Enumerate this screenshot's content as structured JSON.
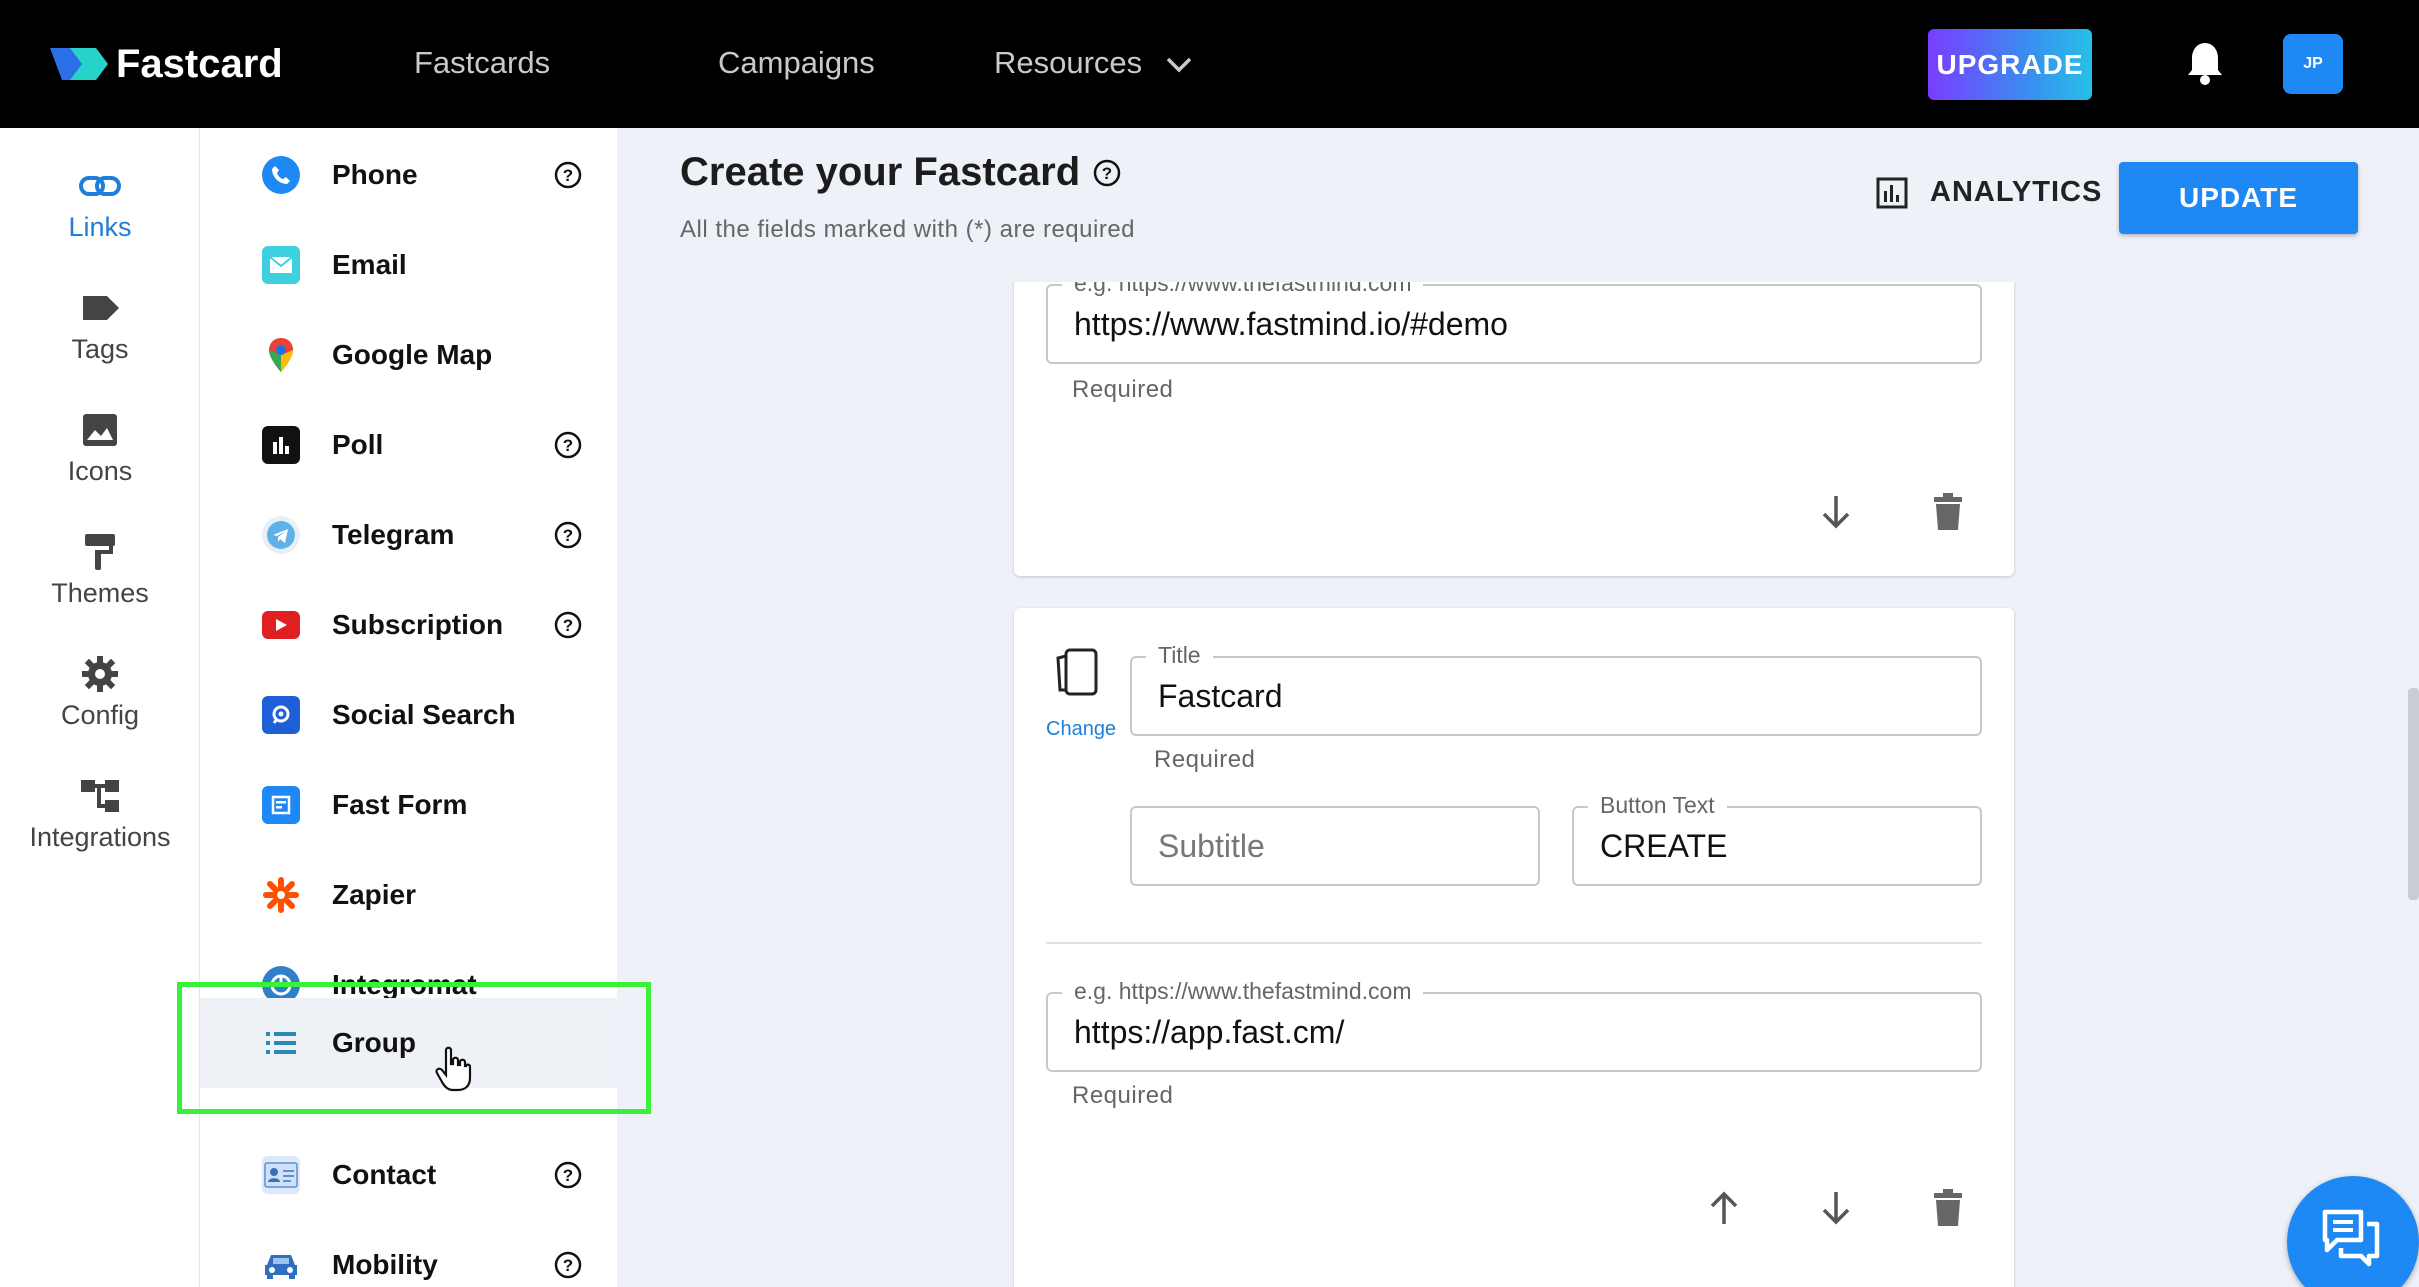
{
  "app": {
    "name": "Fastcard"
  },
  "nav": {
    "fastcards": "Fastcards",
    "campaigns": "Campaigns",
    "resources": "Resources",
    "upgrade": "UPGRADE",
    "avatar_initials": "JP"
  },
  "rail": {
    "items": [
      {
        "label": "Links",
        "icon": "link-icon",
        "active": true
      },
      {
        "label": "Tags",
        "icon": "tag-icon"
      },
      {
        "label": "Icons",
        "icon": "image-icon"
      },
      {
        "label": "Themes",
        "icon": "paint-roller-icon"
      },
      {
        "label": "Config",
        "icon": "gear-icon"
      },
      {
        "label": "Integrations",
        "icon": "integration-icon"
      }
    ]
  },
  "link_types": [
    {
      "label": "Phone",
      "icon": "phone-icon",
      "help": true
    },
    {
      "label": "Email",
      "icon": "email-icon",
      "help": false
    },
    {
      "label": "Google Map",
      "icon": "map-pin-icon",
      "help": false
    },
    {
      "label": "Poll",
      "icon": "poll-icon",
      "help": true
    },
    {
      "label": "Telegram",
      "icon": "telegram-icon",
      "help": true
    },
    {
      "label": "Subscription",
      "icon": "youtube-icon",
      "help": true
    },
    {
      "label": "Social Search",
      "icon": "social-search-icon",
      "help": false
    },
    {
      "label": "Fast Form",
      "icon": "fast-form-icon",
      "help": false
    },
    {
      "label": "Zapier",
      "icon": "zapier-icon",
      "help": false
    },
    {
      "label": "Integromat",
      "icon": "integromat-icon",
      "help": false
    },
    {
      "label": "Group",
      "icon": "list-icon",
      "help": false,
      "selected": true
    },
    {
      "label": "Contact",
      "icon": "contact-card-icon",
      "help": true
    },
    {
      "label": "Mobility",
      "icon": "car-icon",
      "help": true
    }
  ],
  "main": {
    "title": "Create your Fastcard",
    "subtitle": "All the fields marked with (*) are required",
    "analytics": "ANALYTICS",
    "update": "UPDATE"
  },
  "card1": {
    "url_label": "e.g. https://www.thefastmind.com",
    "url_value": "https://www.fastmind.io/#demo",
    "helper": "Required"
  },
  "card2": {
    "change": "Change",
    "title_label": "Title",
    "title_value": "Fastcard",
    "title_helper": "Required",
    "subtitle_placeholder": "Subtitle",
    "button_text_label": "Button Text",
    "button_text_value": "CREATE",
    "url_label": "e.g. https://www.thefastmind.com",
    "url_value": "https://app.fast.cm/",
    "url_helper": "Required"
  },
  "colors": {
    "accent": "#1e88f5",
    "highlight": "#39f03a",
    "upgrade_gradient_start": "#7a3cff",
    "upgrade_gradient_end": "#27c0e6"
  }
}
